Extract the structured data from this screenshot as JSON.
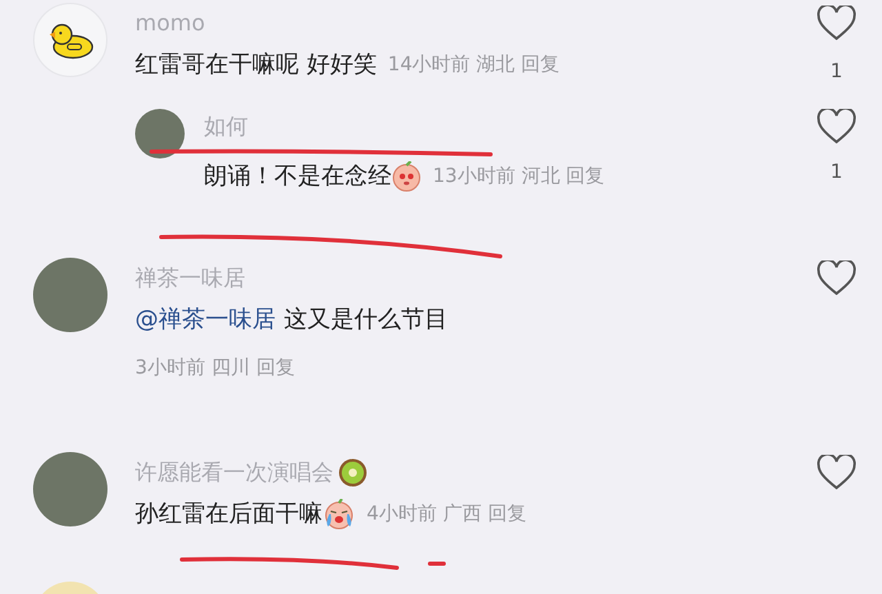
{
  "comments": [
    {
      "avatar": {
        "kind": "duck"
      },
      "username": "momo",
      "text": "红雷哥在干嘛呢 好好笑",
      "kind": "inline",
      "time": "14小时前",
      "location": "湖北",
      "reply": "回复",
      "likes": "1",
      "children": [
        {
          "avatar": {
            "kind": "photo"
          },
          "username": "如何",
          "text": "朗诵！不是在念经",
          "emoji": {
            "kind": "peach"
          },
          "kind": "inline",
          "time": "13小时前",
          "location": "河北",
          "reply": "回复",
          "likes": "1"
        }
      ]
    },
    {
      "avatar": {
        "kind": "photo"
      },
      "username": "禅茶一味居",
      "mention": "@禅茶一味居",
      "text": "这又是什么节目",
      "kind": "below",
      "time": "3小时前",
      "location": "四川",
      "reply": "回复"
    },
    {
      "avatar": {
        "kind": "photo"
      },
      "username": "许愿能看一次演唱会",
      "username_emoji": {
        "kind": "kiwi"
      },
      "text": "孙红雷在后面干嘛",
      "emoji": {
        "kind": "crying"
      },
      "kind": "inline",
      "time": "4小时前",
      "location": "广西",
      "reply": "回复"
    }
  ]
}
